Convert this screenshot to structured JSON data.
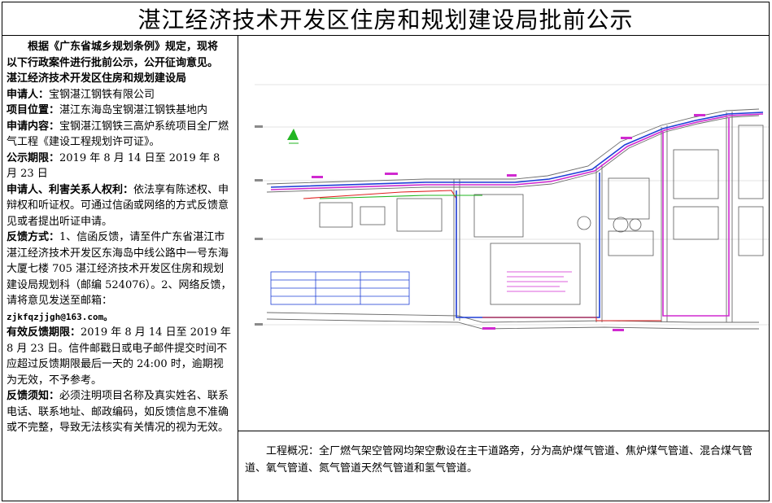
{
  "title": "湛江经济技术开发区住房和规划建设局批前公示",
  "intro": {
    "line1": "根据《广东省城乡规划条例》规定，现将",
    "line2": "以下行政案件进行批前公示，公开征询意见。",
    "line3": "湛江经济技术开发区住房和规划建设局"
  },
  "fields": {
    "applicant_label": "申请人：",
    "applicant": "宝钢湛江钢铁有限公司",
    "location_label": "项目位置：",
    "location": "湛江东海岛宝钢湛江钢铁基地内",
    "content_label": "申请内容：",
    "content": "宝钢湛江钢铁三高炉系统项目全厂燃气工程《建设工程规划许可证》。",
    "period_label": "公示期限：",
    "period": "2019 年 8 月 14 日至 2019 年 8 月 23 日",
    "rights_label": "申请人、利害关系人权利：",
    "rights": "依法享有陈述权、申辩权和听证权。可通过信函或网络的方式反馈意见或者提出听证申请。",
    "method_label": "反馈方式：",
    "method": "1、信函反馈，请至件广东省湛江市湛江经济技术开发区东海岛中线公路中一号东海大厦七楼 705 湛江经济技术开发区住房和规划建设局规划科（邮编 524076）。2、网络反馈，请将意见发送至邮箱：",
    "email": "zjkfqzjjgh@163.com。",
    "valid_label": "有效反馈期限：",
    "valid": "2019 年 8 月 14 日至 2019 年 8 月 23 日。信件邮戳日或电子邮件提交时间不应超过反馈期限最后一天的 24:00 时，逾期视为无效，不予参考。",
    "notice_label": "反馈须知：",
    "notice": "必须注明项目名称及真实姓名、联系电话、联系地址、邮政编码，如反馈信息不准确或不完整，导致无法核实有关情况的视为无效。"
  },
  "overview": "工程概况：全厂燃气架空管网均架空敷设在主干道路旁，分为高炉煤气管道、焦炉煤气管道、混合煤气管道、氧气管道、氮气管道天然气管道和氢气管道。",
  "colors": {
    "pipe_blue": "#1e3fd6",
    "pipe_magenta": "#d02ad0",
    "pipe_red": "#e02020",
    "pipe_green": "#22b522",
    "cad_gray": "#8a8a8a"
  }
}
